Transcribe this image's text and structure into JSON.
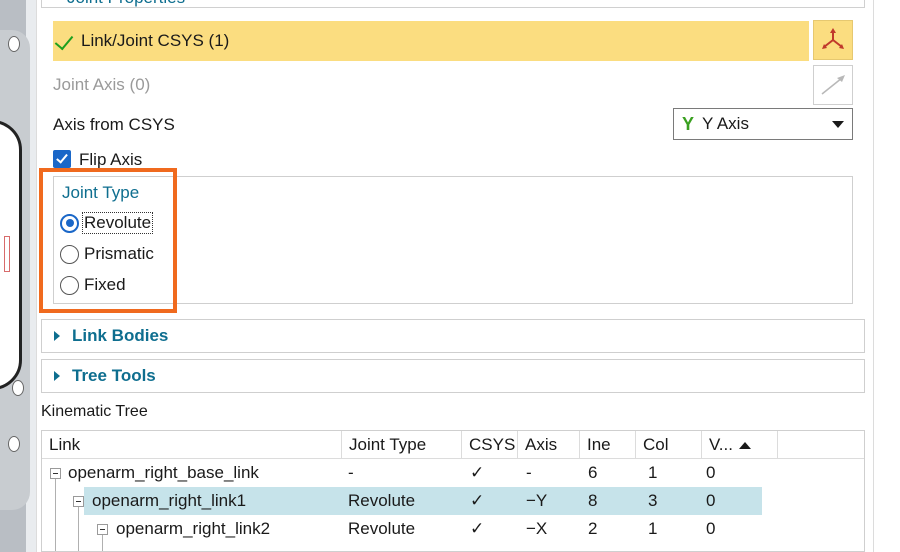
{
  "joint_properties": {
    "title": "Joint Properties",
    "link_joint_csys": {
      "label": "Link/Joint CSYS (1)"
    },
    "joint_axis": {
      "label": "Joint Axis (0)"
    },
    "axis_from_csys": {
      "label": "Axis from CSYS",
      "selected": "Y Axis",
      "glyph": "Y"
    },
    "flip_axis": {
      "label": "Flip Axis",
      "checked": true
    },
    "joint_type": {
      "title": "Joint Type",
      "options": [
        {
          "label": "Revolute",
          "selected": true
        },
        {
          "label": "Prismatic",
          "selected": false
        },
        {
          "label": "Fixed",
          "selected": false
        }
      ]
    }
  },
  "sections": {
    "link_bodies": "Link Bodies",
    "tree_tools": "Tree Tools"
  },
  "kinematic_tree": {
    "title": "Kinematic Tree",
    "columns": [
      "Link",
      "Joint Type",
      "CSYS",
      "Axis",
      "Ine",
      "Col",
      "V..."
    ],
    "rows": [
      {
        "link": "openarm_right_base_link",
        "joint_type": "-",
        "csys": "✓",
        "axis": "-",
        "ine": "6",
        "col": "1",
        "v": "0"
      },
      {
        "link": "openarm_right_link1",
        "joint_type": "Revolute",
        "csys": "✓",
        "axis": "−Y",
        "ine": "8",
        "col": "3",
        "v": "0"
      },
      {
        "link": "openarm_right_link2",
        "joint_type": "Revolute",
        "csys": "✓",
        "axis": "−X",
        "ine": "2",
        "col": "1",
        "v": "0"
      }
    ]
  },
  "colors": {
    "accent": "#0e6e8f",
    "selection": "#fbdd80",
    "highlight_box": "#f06a1e",
    "row_selected": "#c6e3ea",
    "check_blue": "#1a67c8"
  }
}
